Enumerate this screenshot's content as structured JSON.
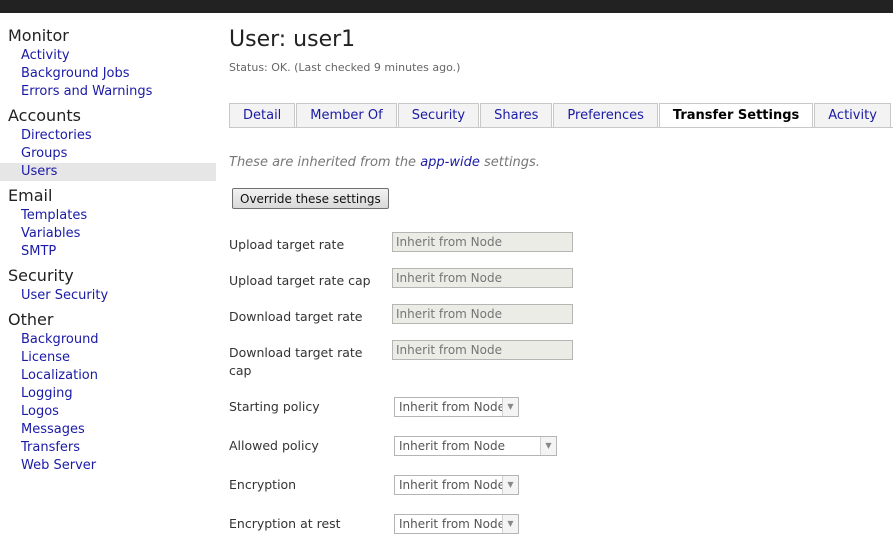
{
  "sidebar": {
    "sections": [
      {
        "title": "Monitor",
        "items": [
          "Activity",
          "Background Jobs",
          "Errors and Warnings"
        ]
      },
      {
        "title": "Accounts",
        "items": [
          "Directories",
          "Groups",
          "Users"
        ]
      },
      {
        "title": "Email",
        "items": [
          "Templates",
          "Variables",
          "SMTP"
        ]
      },
      {
        "title": "Security",
        "items": [
          "User Security"
        ]
      },
      {
        "title": "Other",
        "items": [
          "Background",
          "License",
          "Localization",
          "Logging",
          "Logos",
          "Messages",
          "Transfers",
          "Web Server"
        ]
      }
    ],
    "active_item": "Users"
  },
  "page": {
    "title": "User: user1",
    "status": "Status: OK. (Last checked 9 minutes ago.)"
  },
  "tabs": [
    "Detail",
    "Member Of",
    "Security",
    "Shares",
    "Preferences",
    "Transfer Settings",
    "Activity"
  ],
  "active_tab": "Transfer Settings",
  "inherit_note": {
    "prefix": "These are inherited from the ",
    "link": "app-wide",
    "suffix": " settings."
  },
  "override_button": "Override these settings",
  "fields": {
    "upload_rate": {
      "label": "Upload target rate",
      "placeholder": "Inherit from Node"
    },
    "upload_rate_cap": {
      "label": "Upload target rate cap",
      "placeholder": "Inherit from Node"
    },
    "download_rate": {
      "label": "Download target rate",
      "placeholder": "Inherit from Node"
    },
    "download_rate_cap": {
      "label": "Download target rate cap",
      "placeholder": "Inherit from Node"
    },
    "starting_policy": {
      "label": "Starting policy",
      "value": "Inherit from Node"
    },
    "allowed_policy": {
      "label": "Allowed policy",
      "value": "Inherit from Node"
    },
    "encryption": {
      "label": "Encryption",
      "value": "Inherit from Node"
    },
    "encryption_at_rest": {
      "label": "Encryption at rest",
      "value": "Inherit from Node"
    }
  }
}
